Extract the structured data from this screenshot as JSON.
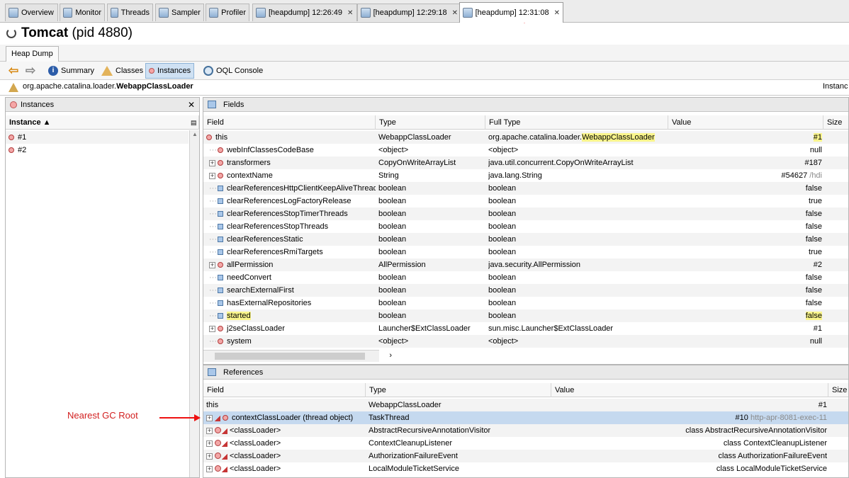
{
  "tabs": [
    {
      "label": "Overview",
      "icon": "overview-icon"
    },
    {
      "label": "Monitor",
      "icon": "monitor-icon"
    },
    {
      "label": "Threads",
      "icon": "threads-icon"
    },
    {
      "label": "Sampler",
      "icon": "sampler-icon"
    },
    {
      "label": "Profiler",
      "icon": "profiler-icon"
    },
    {
      "label": "[heapdump] 12:26:49",
      "icon": "heapdump-icon",
      "closable": true
    },
    {
      "label": "[heapdump] 12:29:18",
      "icon": "heapdump-icon",
      "closable": true
    },
    {
      "label": "[heapdump] 12:31:08",
      "icon": "heapdump-icon",
      "closable": true,
      "active": true
    }
  ],
  "header": {
    "title": "Tomcat",
    "pid": "(pid 4880)"
  },
  "subtab": "Heap Dump",
  "toolbar": {
    "summary": "Summary",
    "classes": "Classes",
    "instances": "Instances",
    "oql": "OQL Console"
  },
  "path": {
    "prefix": "org.apache.catalina.loader.",
    "cls": "WebappClassLoader",
    "right": "Instanc"
  },
  "instances": {
    "title": "Instances",
    "col": "Instance ▲",
    "rows": [
      "#1",
      "#2"
    ]
  },
  "fields": {
    "title": "Fields",
    "cols": [
      "Field",
      "Type",
      "Full Type",
      "Value",
      "Size"
    ],
    "rows": [
      {
        "f": "this",
        "t": "WebappClassLoader",
        "ftp": "org.apache.catalina.loader.",
        "fthl": "WebappClassLoader",
        "v": "#1",
        "vhl": true,
        "ic": "ring",
        "exp": false,
        "root": true
      },
      {
        "f": "webInfClassesCodeBase",
        "t": "<object>",
        "ftp": "<object>",
        "v": "null",
        "ic": "ring",
        "exp": false
      },
      {
        "f": "transformers",
        "t": "CopyOnWriteArrayList",
        "ftp": "java.util.concurrent.CopyOnWriteArrayList",
        "v": "#187",
        "ic": "ring",
        "exp": true
      },
      {
        "f": "contextName",
        "t": "String",
        "ftp": "java.lang.String",
        "v": "#54627",
        "vx": " /hdi",
        "ic": "ring",
        "exp": true
      },
      {
        "f": "clearReferencesHttpClientKeepAliveThread",
        "t": "boolean",
        "ftp": "boolean",
        "v": "false",
        "ic": "sq",
        "exp": false
      },
      {
        "f": "clearReferencesLogFactoryRelease",
        "t": "boolean",
        "ftp": "boolean",
        "v": "true",
        "ic": "sq",
        "exp": false
      },
      {
        "f": "clearReferencesStopTimerThreads",
        "t": "boolean",
        "ftp": "boolean",
        "v": "false",
        "ic": "sq",
        "exp": false
      },
      {
        "f": "clearReferencesStopThreads",
        "t": "boolean",
        "ftp": "boolean",
        "v": "false",
        "ic": "sq",
        "exp": false
      },
      {
        "f": "clearReferencesStatic",
        "t": "boolean",
        "ftp": "boolean",
        "v": "false",
        "ic": "sq",
        "exp": false
      },
      {
        "f": "clearReferencesRmiTargets",
        "t": "boolean",
        "ftp": "boolean",
        "v": "true",
        "ic": "sq",
        "exp": false
      },
      {
        "f": "allPermission",
        "t": "AllPermission",
        "ftp": "java.security.AllPermission",
        "v": "#2",
        "ic": "ring",
        "exp": true
      },
      {
        "f": "needConvert",
        "t": "boolean",
        "ftp": "boolean",
        "v": "false",
        "ic": "sq",
        "exp": false
      },
      {
        "f": "searchExternalFirst",
        "t": "boolean",
        "ftp": "boolean",
        "v": "false",
        "ic": "sq",
        "exp": false
      },
      {
        "f": "hasExternalRepositories",
        "t": "boolean",
        "ftp": "boolean",
        "v": "false",
        "ic": "sq",
        "exp": false
      },
      {
        "f": "started",
        "t": "boolean",
        "ftp": "boolean",
        "v": "false",
        "ic": "sq",
        "exp": false,
        "fhl": true,
        "vhl": true
      },
      {
        "f": "j2seClassLoader",
        "t": "Launcher$ExtClassLoader",
        "ftp": "sun.misc.Launcher$ExtClassLoader",
        "v": "#1",
        "ic": "ring",
        "exp": true
      },
      {
        "f": "system",
        "t": "<object>",
        "ftp": "<object>",
        "v": "null",
        "ic": "ring",
        "exp": false
      }
    ]
  },
  "refs": {
    "title": "References",
    "cols": [
      "Field",
      "Type",
      "Value",
      "Size"
    ],
    "rows": [
      {
        "f": "this",
        "t": "WebappClassLoader",
        "v": "#1",
        "exp": false,
        "ic": "none"
      },
      {
        "f": "contextClassLoader (thread object)",
        "t": "TaskThread",
        "v": "#10",
        "vx": " http-apr-8081-exec-11",
        "exp": true,
        "ic": "gcroot",
        "selected": true
      },
      {
        "f": "<classLoader>",
        "t": "AbstractRecursiveAnnotationVisitor",
        "v": "class AbstractRecursiveAnnotationVisitor",
        "exp": true,
        "ic": "gc"
      },
      {
        "f": "<classLoader>",
        "t": "ContextCleanupListener",
        "v": "class ContextCleanupListener",
        "exp": true,
        "ic": "gc"
      },
      {
        "f": "<classLoader>",
        "t": "AuthorizationFailureEvent",
        "v": "class AuthorizationFailureEvent",
        "exp": true,
        "ic": "gc"
      },
      {
        "f": "<classLoader>",
        "t": "LocalModuleTicketService",
        "v": "class LocalModuleTicketService",
        "exp": true,
        "ic": "gc"
      }
    ]
  },
  "annotation": "Nearest GC Root"
}
